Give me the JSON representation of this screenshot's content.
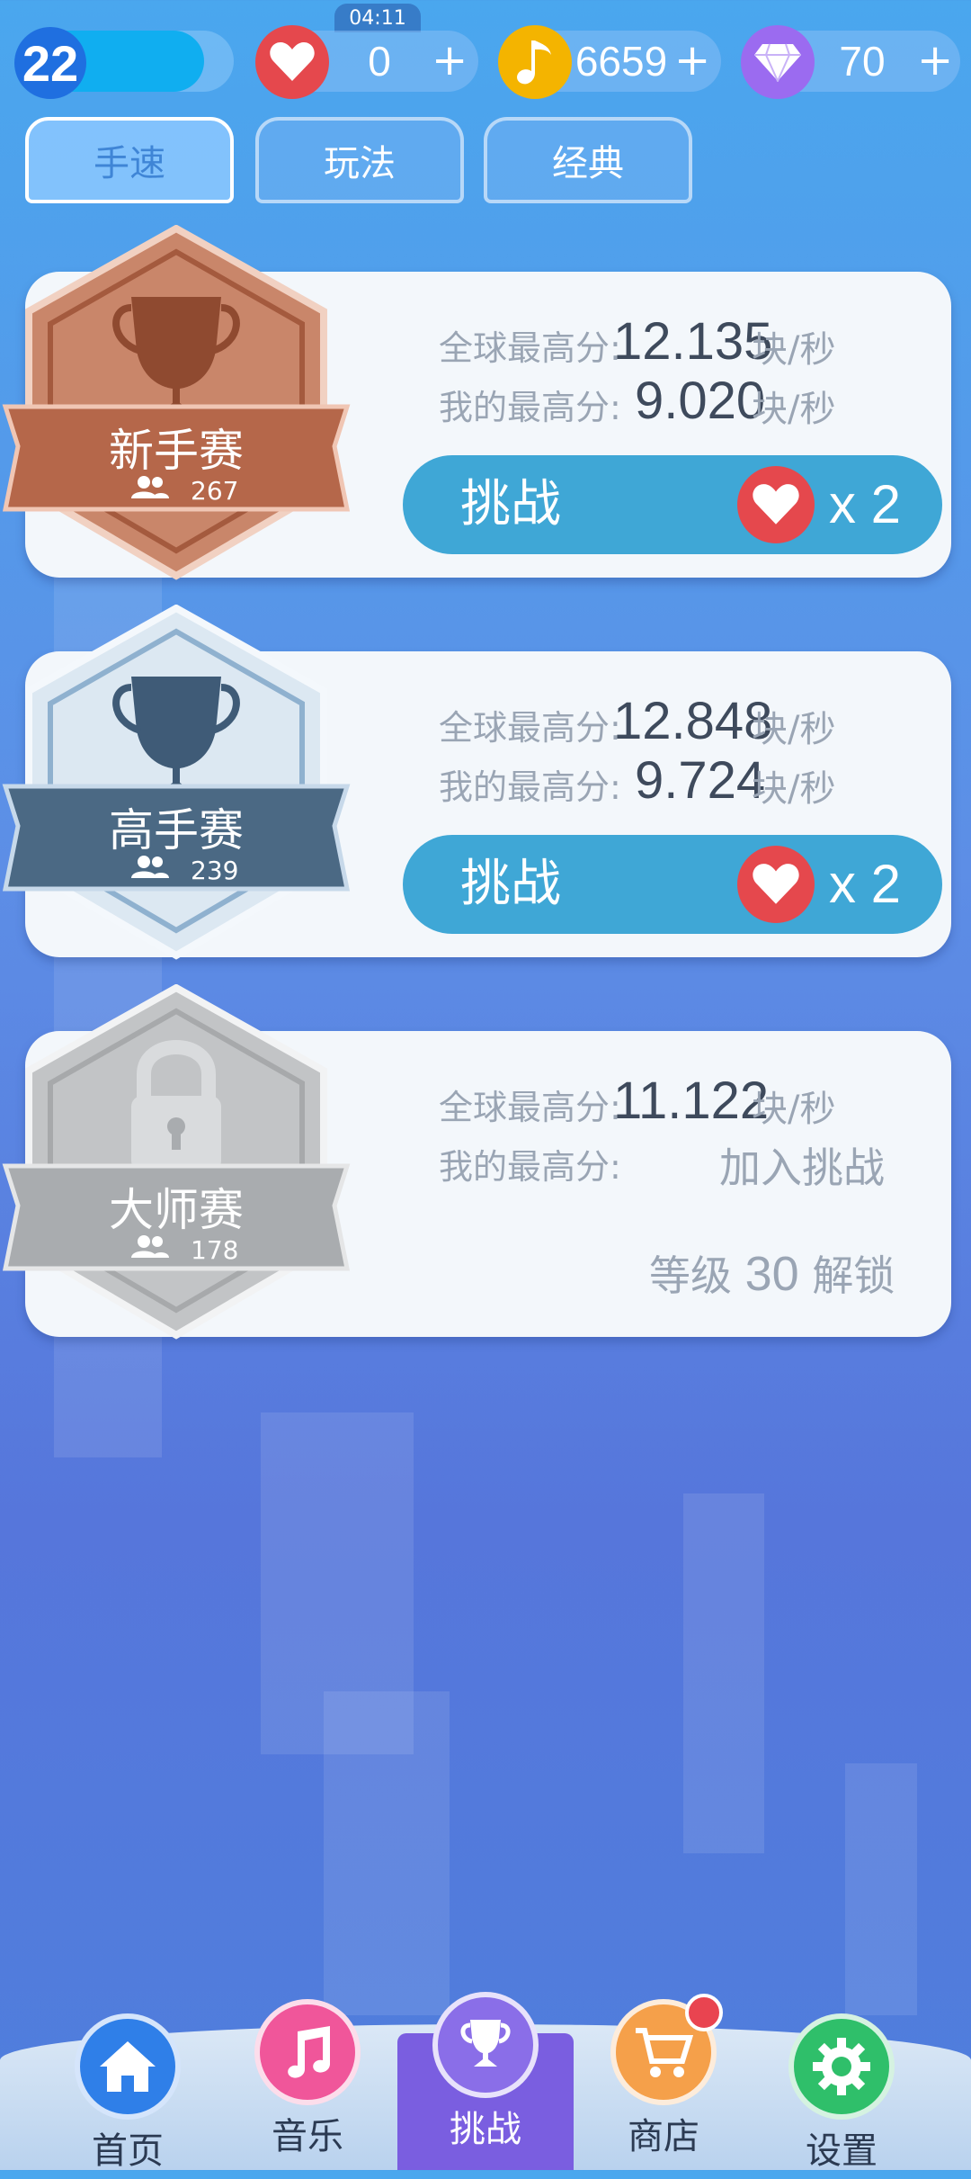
{
  "status": {
    "timer": "04:11"
  },
  "topbar": {
    "level": "22",
    "xp_progress": 0.85,
    "lives": "0",
    "notes": "6659",
    "diamonds": "70",
    "plus": "+"
  },
  "tabs": [
    {
      "label": "手速",
      "active": true
    },
    {
      "label": "玩法",
      "active": false
    },
    {
      "label": "经典",
      "active": false
    }
  ],
  "cards": [
    {
      "name": "新手赛",
      "players": "267",
      "global_label": "全球最高分:",
      "global_value": "12.135",
      "mine_label": "我的最高分:",
      "mine_value": "9.020",
      "unit": "块/秒",
      "button_label": "挑战",
      "cost": "x 2",
      "color": "#b5674a"
    },
    {
      "name": "高手赛",
      "players": "239",
      "global_label": "全球最高分:",
      "global_value": "12.848",
      "mine_label": "我的最高分:",
      "mine_value": "9.724",
      "unit": "块/秒",
      "button_label": "挑战",
      "cost": "x 2",
      "color": "#4b6984"
    },
    {
      "name": "大师赛",
      "players": "178",
      "global_label": "全球最高分:",
      "global_value": "11.122",
      "mine_label": "我的最高分:",
      "mine_value": "加入挑战",
      "unit": "块/秒",
      "unlock_prefix": "等级",
      "unlock_level": "30",
      "unlock_suffix": "解锁",
      "color": "#a9acaf"
    }
  ],
  "nav": [
    {
      "label": "首页",
      "icon": "home-icon"
    },
    {
      "label": "音乐",
      "icon": "music-icon"
    },
    {
      "label": "挑战",
      "icon": "trophy-icon",
      "active": true
    },
    {
      "label": "商店",
      "icon": "cart-icon"
    },
    {
      "label": "设置",
      "icon": "gear-icon"
    }
  ],
  "colors": {
    "accent_blue": "#3fa7d6",
    "heart_red": "#e5484d",
    "note_gold": "#f4b400",
    "diamond_purple": "#9b6bf0",
    "nav_active": "#7a5ee0"
  }
}
